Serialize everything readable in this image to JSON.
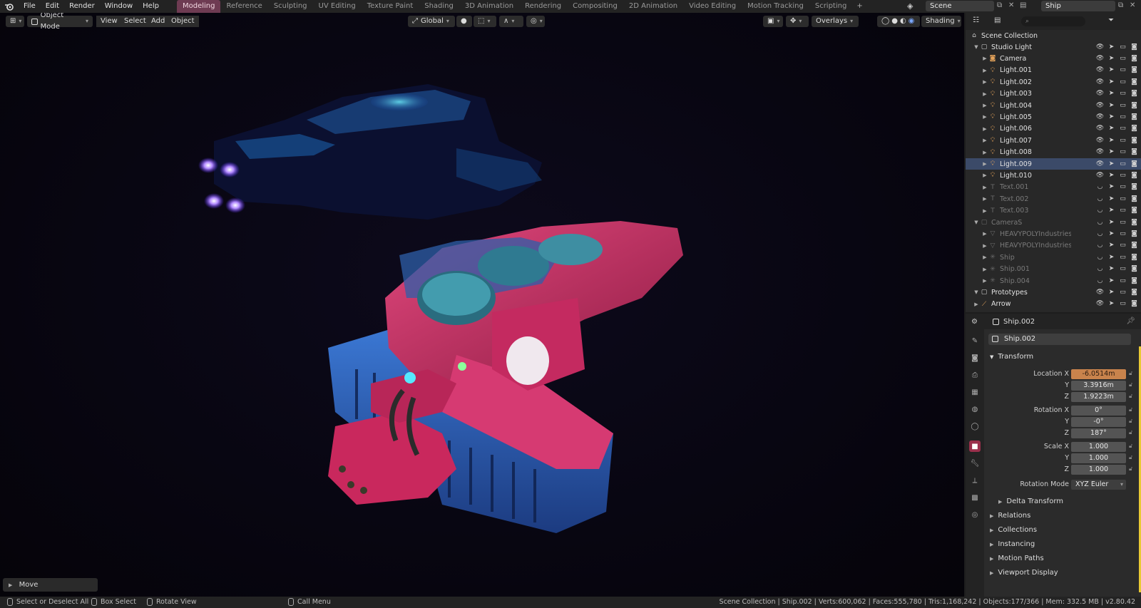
{
  "top_menu": [
    "File",
    "Edit",
    "Render",
    "Window",
    "Help"
  ],
  "workspaces": {
    "active": "Modeling",
    "tabs": [
      "Modeling",
      "Reference",
      "Sculpting",
      "UV Editing",
      "Texture Paint",
      "Shading",
      "3D Animation",
      "Rendering",
      "Compositing",
      "2D Animation",
      "Video Editing",
      "Motion Tracking",
      "Scripting"
    ],
    "add": "+"
  },
  "scene_name": "Scene",
  "view_layer": "Ship",
  "viewport": {
    "mode": "Object Mode",
    "menus": [
      "View",
      "Select",
      "Add",
      "Object"
    ],
    "orientation": "Global",
    "overlays_label": "Overlays",
    "shading_label": "Shading",
    "last_operator": "Move"
  },
  "outliner": {
    "search_placeholder": "",
    "root": "Scene Collection",
    "rows": [
      {
        "label": "Studio Light",
        "type": "collection",
        "depth": 1,
        "dim": false,
        "selected": false
      },
      {
        "label": "Camera",
        "type": "camera",
        "depth": 2,
        "dim": false,
        "selected": false
      },
      {
        "label": "Light.001",
        "type": "light",
        "depth": 2,
        "dim": false,
        "selected": false
      },
      {
        "label": "Light.002",
        "type": "light",
        "depth": 2,
        "dim": false,
        "selected": false
      },
      {
        "label": "Light.003",
        "type": "light",
        "depth": 2,
        "dim": false,
        "selected": false
      },
      {
        "label": "Light.004",
        "type": "light",
        "depth": 2,
        "dim": false,
        "selected": false
      },
      {
        "label": "Light.005",
        "type": "light",
        "depth": 2,
        "dim": false,
        "selected": false
      },
      {
        "label": "Light.006",
        "type": "light",
        "depth": 2,
        "dim": false,
        "selected": false
      },
      {
        "label": "Light.007",
        "type": "light",
        "depth": 2,
        "dim": false,
        "selected": false
      },
      {
        "label": "Light.008",
        "type": "light",
        "depth": 2,
        "dim": false,
        "selected": false
      },
      {
        "label": "Light.009",
        "type": "light",
        "depth": 2,
        "dim": false,
        "selected": true
      },
      {
        "label": "Light.010",
        "type": "light",
        "depth": 2,
        "dim": false,
        "selected": false
      },
      {
        "label": "Text.001",
        "type": "text",
        "depth": 2,
        "dim": true,
        "selected": false
      },
      {
        "label": "Text.002",
        "type": "text",
        "depth": 2,
        "dim": true,
        "selected": false
      },
      {
        "label": "Text.003",
        "type": "text",
        "depth": 2,
        "dim": true,
        "selected": false
      },
      {
        "label": "CameraS",
        "type": "collection",
        "depth": 1,
        "dim": true,
        "selected": false
      },
      {
        "label": "HEAVYPOLYIndustriesTra",
        "type": "cone",
        "depth": 2,
        "dim": true,
        "selected": false
      },
      {
        "label": "HEAVYPOLYIndustriesTra",
        "type": "cone",
        "depth": 2,
        "dim": true,
        "selected": false
      },
      {
        "label": "Ship",
        "type": "empty",
        "depth": 2,
        "dim": true,
        "selected": false
      },
      {
        "label": "Ship.001",
        "type": "empty",
        "depth": 2,
        "dim": true,
        "selected": false
      },
      {
        "label": "Ship.004",
        "type": "empty",
        "depth": 2,
        "dim": true,
        "selected": false
      },
      {
        "label": "Prototypes",
        "type": "collection",
        "depth": 1,
        "dim": false,
        "selected": false
      },
      {
        "label": "Arrow",
        "type": "armature",
        "depth": 1,
        "dim": false,
        "selected": false
      }
    ]
  },
  "properties": {
    "header_object": "Ship.002",
    "object_name": "Ship.002",
    "transform_label": "Transform",
    "location": {
      "label": "Location X",
      "x": "-6.0514m",
      "y": "3.3916m",
      "z": "1.9223m"
    },
    "rotation": {
      "label": "Rotation X",
      "x": "0°",
      "y": "-0°",
      "z": "187°"
    },
    "scale": {
      "label": "Scale X",
      "x": "1.000",
      "y": "1.000",
      "z": "1.000"
    },
    "axis_y": "Y",
    "axis_z": "Z",
    "rotation_mode_label": "Rotation Mode",
    "rotation_mode": "XYZ Euler",
    "subpanels": [
      "Delta Transform",
      "Relations",
      "Collections",
      "Instancing",
      "Motion Paths",
      "Viewport Display"
    ]
  },
  "statusbar": {
    "left": [
      {
        "label": "Select or Deselect All"
      },
      {
        "label": "Box Select"
      },
      {
        "label": "Rotate View"
      },
      {
        "label": "Call Menu"
      }
    ],
    "stats": "Scene Collection | Ship.002 | Verts:600,062 | Faces:555,780 | Tris:1,168,242 | Objects:177/366 | Mem: 332.5 MB | v2.80.42"
  },
  "colors": {
    "active_tab": "#6e3b52",
    "selection_row": "#3b4a68",
    "animated_field": "#c9834c",
    "ship_pink": "#d2306a",
    "ship_blue": "#2f5fb8"
  }
}
